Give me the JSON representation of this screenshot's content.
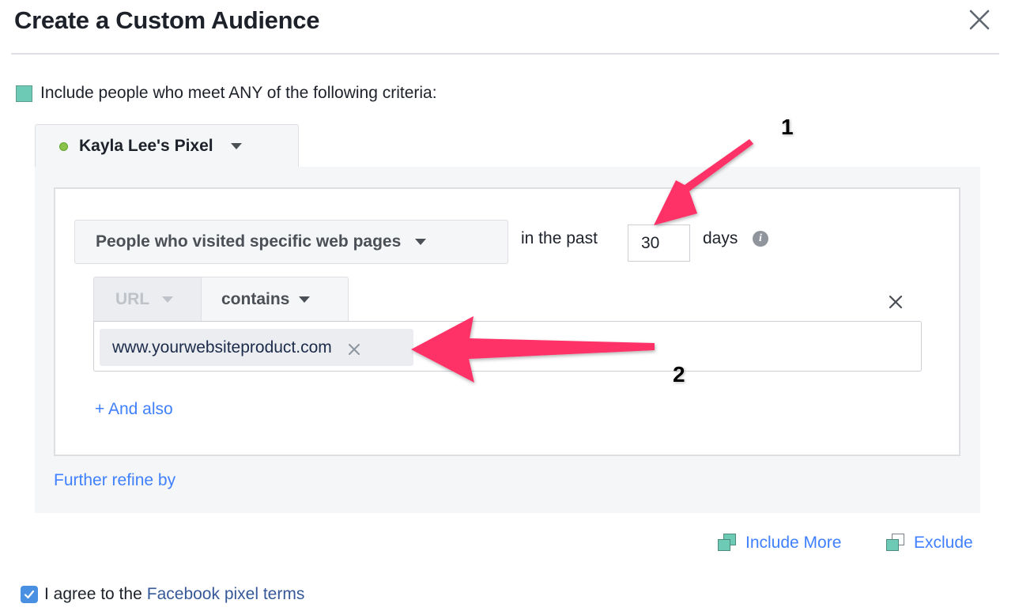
{
  "dialog": {
    "title": "Create a Custom Audience",
    "close_icon": "close-icon"
  },
  "criteria": {
    "label": "Include people who meet ANY of the following criteria:",
    "color": "#6dcbb5"
  },
  "pixel": {
    "name": "Kayla Lee's Pixel",
    "status_color": "#8bc34a"
  },
  "rule": {
    "event_select": "People who visited specific web pages",
    "in_the_past_label": "in the past",
    "days_value": "30",
    "days_label": "days",
    "info_icon": "i",
    "url_select": "URL",
    "operator_select": "contains",
    "url_tokens": [
      "www.yourwebsiteproduct.com"
    ],
    "and_also": "+ And also"
  },
  "further_refine": "Further refine by",
  "actions": {
    "include_more": "Include More",
    "exclude": "Exclude"
  },
  "agreement": {
    "checked": true,
    "prefix": "I agree to the",
    "link_text": "Facebook pixel terms"
  },
  "annotations": {
    "labels": [
      "1",
      "2"
    ],
    "color": "#ff3068"
  },
  "colors": {
    "link": "#4080ff",
    "terms_link": "#365899",
    "checkbox": "#4a90e2"
  }
}
